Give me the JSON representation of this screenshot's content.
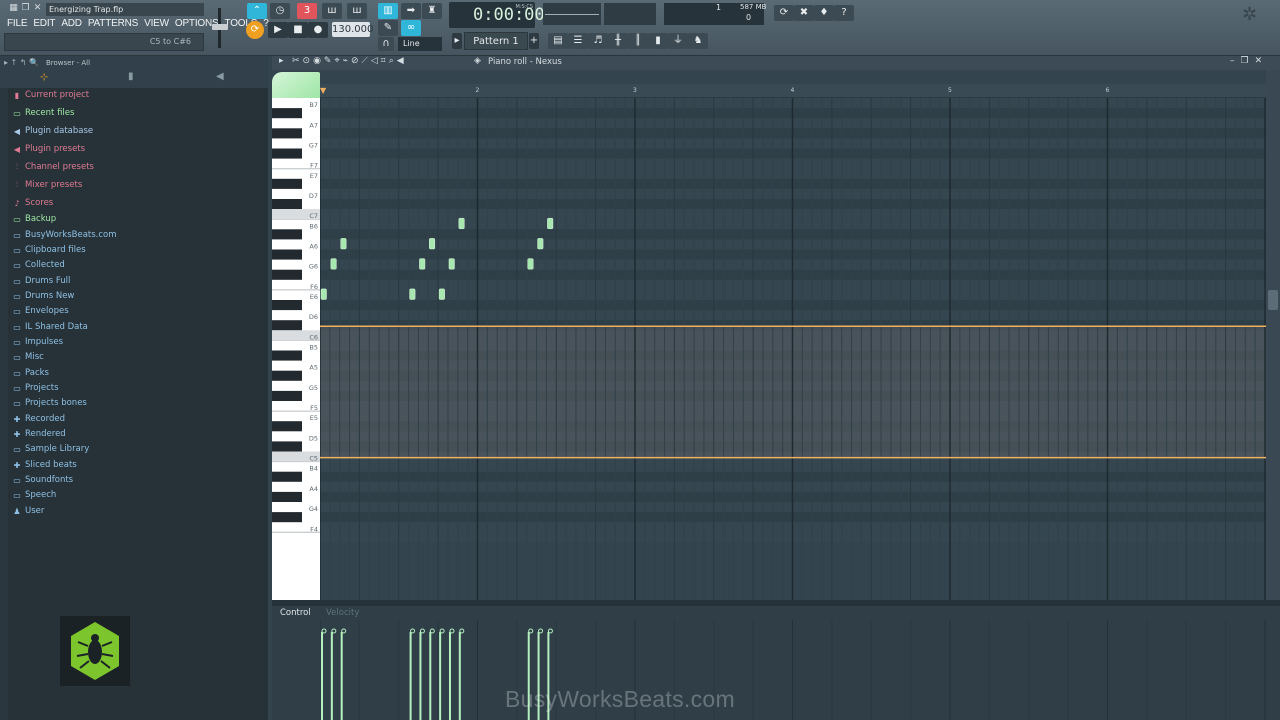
{
  "titlebar": {
    "project_title": "Energizing Trap.flp"
  },
  "menu": [
    "FILE",
    "EDIT",
    "ADD",
    "PATTERNS",
    "VIEW",
    "OPTIONS",
    "TOOLS",
    "?"
  ],
  "hint": "C5 to C#6",
  "transport": {
    "tempo": "130.000",
    "time": "0:00:00",
    "time_label": "M:S:CS",
    "snap": "Line",
    "pattern": "Pattern 1"
  },
  "monitor": {
    "cpu": "1",
    "memory": "587 MB",
    "poly": "0"
  },
  "browser": {
    "title": "Browser - All",
    "items": [
      {
        "label": "Current project",
        "icon": "file-icon",
        "kind": "pink"
      },
      {
        "label": "Recent files",
        "icon": "folder-icon",
        "kind": "green"
      },
      {
        "label": "Plugin database",
        "icon": "plug-icon",
        "kind": "blue"
      },
      {
        "label": "Plugin presets",
        "icon": "plug-icon",
        "kind": "pink"
      },
      {
        "label": "Channel presets",
        "icon": "channel-icon",
        "kind": "pink"
      },
      {
        "label": "Mixer presets",
        "icon": "mixer-icon",
        "kind": "pink"
      },
      {
        "label": "Scores",
        "icon": "note-icon",
        "kind": "pink"
      },
      {
        "label": "Backup",
        "icon": "folder-icon",
        "kind": "green"
      },
      {
        "label": "BusyWorksBeats.com",
        "icon": "folder-icon",
        "kind": "folder"
      },
      {
        "label": "Clipboard files",
        "icon": "folder-icon",
        "kind": "folder"
      },
      {
        "label": "Collected",
        "icon": "folder-icon",
        "kind": "folder"
      },
      {
        "label": "Drums Full",
        "icon": "folder-icon",
        "kind": "folder"
      },
      {
        "label": "Drums New",
        "icon": "folder-icon",
        "kind": "folder"
      },
      {
        "label": "Envelopes",
        "icon": "folder-icon",
        "kind": "folder"
      },
      {
        "label": "IL Shared Data",
        "icon": "folder-icon",
        "kind": "folder"
      },
      {
        "label": "Impulses",
        "icon": "folder-icon",
        "kind": "folder"
      },
      {
        "label": "Misc",
        "icon": "folder-icon",
        "kind": "folder"
      },
      {
        "label": "Packs",
        "icon": "folder-icon",
        "kind": "folder"
      },
      {
        "label": "Projects",
        "icon": "folder-icon",
        "kind": "folder"
      },
      {
        "label": "Projects bones",
        "icon": "folder-icon",
        "kind": "folder"
      },
      {
        "label": "Recorded",
        "icon": "plus-icon",
        "kind": "folder"
      },
      {
        "label": "Rendered",
        "icon": "plus-icon",
        "kind": "folder"
      },
      {
        "label": "Sample Library",
        "icon": "folder-icon",
        "kind": "folder"
      },
      {
        "label": "Sliced beats",
        "icon": "plus-icon",
        "kind": "folder"
      },
      {
        "label": "Soundfonts",
        "icon": "folder-icon",
        "kind": "folder"
      },
      {
        "label": "Speech",
        "icon": "folder-icon",
        "kind": "folder"
      },
      {
        "label": "User",
        "icon": "user-icon",
        "kind": "folder"
      }
    ]
  },
  "piano_roll": {
    "title": "Piano roll - Nexus",
    "bar_numbers": [
      "2",
      "3",
      "4",
      "5",
      "6"
    ],
    "key_labels": [
      "B7",
      "A7",
      "G7",
      "F7",
      "E7",
      "D7",
      "C7",
      "B6",
      "A6",
      "G6",
      "F6",
      "E6",
      "D6",
      "C6",
      "B5",
      "A5",
      "G5",
      "F5",
      "E5",
      "D5",
      "C5",
      "B4",
      "A4",
      "G4",
      "F4"
    ],
    "notes": [
      {
        "step": 0,
        "pitch": "E6"
      },
      {
        "step": 1,
        "pitch": "G6"
      },
      {
        "step": 2,
        "pitch": "A6"
      },
      {
        "step": 9,
        "pitch": "E6"
      },
      {
        "step": 10,
        "pitch": "G6"
      },
      {
        "step": 11,
        "pitch": "A6"
      },
      {
        "step": 12,
        "pitch": "E6"
      },
      {
        "step": 13,
        "pitch": "G6"
      },
      {
        "step": 14,
        "pitch": "B6"
      },
      {
        "step": 21,
        "pitch": "G6"
      },
      {
        "step": 22,
        "pitch": "A6"
      },
      {
        "step": 23,
        "pitch": "B6"
      }
    ],
    "range_markers": [
      "C6",
      "C5"
    ],
    "accent_color": "#f0b060",
    "note_color": "#a8e8b0"
  },
  "event_pane": {
    "control_label": "Control",
    "velocity_label": "Velocity"
  },
  "watermark": "BusyWorksBeats.com"
}
